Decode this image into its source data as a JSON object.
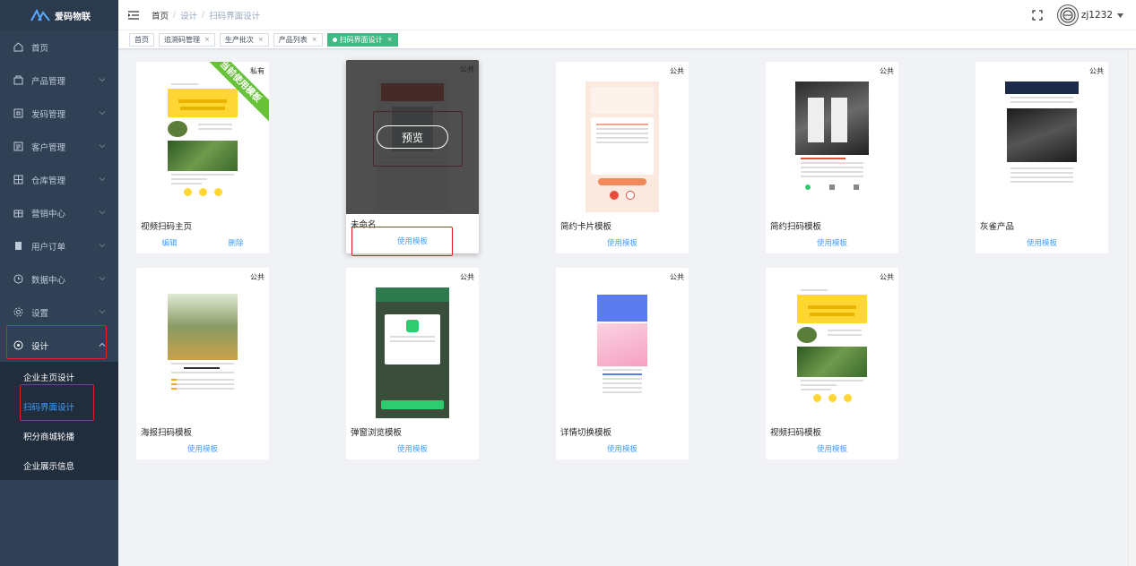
{
  "app": {
    "name": "爱码物联"
  },
  "sidebar": {
    "items": [
      {
        "label": "首页"
      },
      {
        "label": "产品管理"
      },
      {
        "label": "发码管理"
      },
      {
        "label": "客户管理"
      },
      {
        "label": "仓库管理"
      },
      {
        "label": "营销中心"
      },
      {
        "label": "用户订单"
      },
      {
        "label": "数据中心"
      },
      {
        "label": "设置"
      },
      {
        "label": "设计"
      }
    ],
    "design_submenu": [
      {
        "label": "企业主页设计"
      },
      {
        "label": "扫码界面设计"
      },
      {
        "label": "积分商城轮播"
      },
      {
        "label": "企业展示信息"
      }
    ]
  },
  "header": {
    "breadcrumb": [
      "首页",
      "设计",
      "扫码界面设计"
    ],
    "username": "zj1232"
  },
  "tags": [
    "首页",
    "追溯码管理",
    "生产批次",
    "产品列表",
    "扫码界面设计"
  ],
  "cards": [
    {
      "title": "视频扫码主页",
      "badge": "私有",
      "ribbon": "当前使用模板",
      "actions": [
        "编辑",
        "删除"
      ]
    },
    {
      "title": "未命名",
      "badge": "公共",
      "overlay": "预览",
      "actions": [
        "使用模板"
      ]
    },
    {
      "title": "简约卡片模板",
      "badge": "公共",
      "actions": [
        "使用模板"
      ]
    },
    {
      "title": "简约扫码模板",
      "badge": "公共",
      "actions": [
        "使用模板"
      ]
    },
    {
      "title": "灰雀产品",
      "badge": "公共",
      "actions": [
        "使用模板"
      ]
    },
    {
      "title": "海报扫码模板",
      "badge": "公共",
      "actions": [
        "使用模板"
      ]
    },
    {
      "title": "弹窗浏览模板",
      "badge": "公共",
      "actions": [
        "使用模板"
      ]
    },
    {
      "title": "详情切换模板",
      "badge": "公共",
      "actions": [
        "使用模板"
      ]
    },
    {
      "title": "视频扫码模板",
      "badge": "公共",
      "actions": [
        "使用模板"
      ]
    }
  ],
  "colors": {
    "sidebar": "#304156",
    "accent": "#409eff",
    "active_tag": "#42b983",
    "highlight": "#e02020"
  }
}
